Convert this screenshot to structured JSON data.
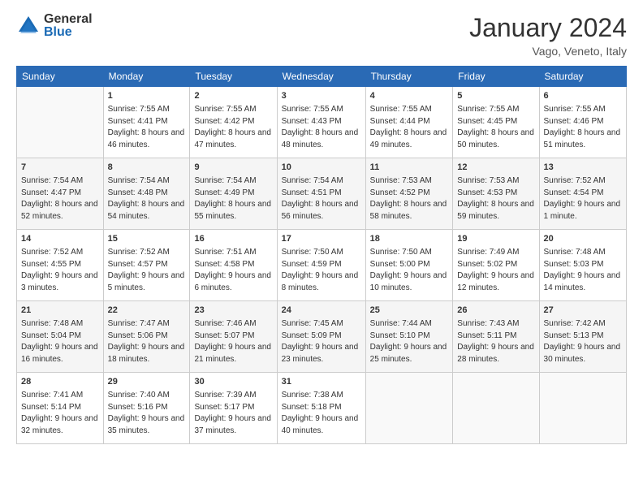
{
  "header": {
    "logo": {
      "general": "General",
      "blue": "Blue"
    },
    "title": "January 2024",
    "location": "Vago, Veneto, Italy"
  },
  "columns": [
    "Sunday",
    "Monday",
    "Tuesday",
    "Wednesday",
    "Thursday",
    "Friday",
    "Saturday"
  ],
  "weeks": [
    [
      {
        "day": "",
        "sunrise": "",
        "sunset": "",
        "daylight": ""
      },
      {
        "day": "1",
        "sunrise": "Sunrise: 7:55 AM",
        "sunset": "Sunset: 4:41 PM",
        "daylight": "Daylight: 8 hours and 46 minutes."
      },
      {
        "day": "2",
        "sunrise": "Sunrise: 7:55 AM",
        "sunset": "Sunset: 4:42 PM",
        "daylight": "Daylight: 8 hours and 47 minutes."
      },
      {
        "day": "3",
        "sunrise": "Sunrise: 7:55 AM",
        "sunset": "Sunset: 4:43 PM",
        "daylight": "Daylight: 8 hours and 48 minutes."
      },
      {
        "day": "4",
        "sunrise": "Sunrise: 7:55 AM",
        "sunset": "Sunset: 4:44 PM",
        "daylight": "Daylight: 8 hours and 49 minutes."
      },
      {
        "day": "5",
        "sunrise": "Sunrise: 7:55 AM",
        "sunset": "Sunset: 4:45 PM",
        "daylight": "Daylight: 8 hours and 50 minutes."
      },
      {
        "day": "6",
        "sunrise": "Sunrise: 7:55 AM",
        "sunset": "Sunset: 4:46 PM",
        "daylight": "Daylight: 8 hours and 51 minutes."
      }
    ],
    [
      {
        "day": "7",
        "sunrise": "Sunrise: 7:54 AM",
        "sunset": "Sunset: 4:47 PM",
        "daylight": "Daylight: 8 hours and 52 minutes."
      },
      {
        "day": "8",
        "sunrise": "Sunrise: 7:54 AM",
        "sunset": "Sunset: 4:48 PM",
        "daylight": "Daylight: 8 hours and 54 minutes."
      },
      {
        "day": "9",
        "sunrise": "Sunrise: 7:54 AM",
        "sunset": "Sunset: 4:49 PM",
        "daylight": "Daylight: 8 hours and 55 minutes."
      },
      {
        "day": "10",
        "sunrise": "Sunrise: 7:54 AM",
        "sunset": "Sunset: 4:51 PM",
        "daylight": "Daylight: 8 hours and 56 minutes."
      },
      {
        "day": "11",
        "sunrise": "Sunrise: 7:53 AM",
        "sunset": "Sunset: 4:52 PM",
        "daylight": "Daylight: 8 hours and 58 minutes."
      },
      {
        "day": "12",
        "sunrise": "Sunrise: 7:53 AM",
        "sunset": "Sunset: 4:53 PM",
        "daylight": "Daylight: 8 hours and 59 minutes."
      },
      {
        "day": "13",
        "sunrise": "Sunrise: 7:52 AM",
        "sunset": "Sunset: 4:54 PM",
        "daylight": "Daylight: 9 hours and 1 minute."
      }
    ],
    [
      {
        "day": "14",
        "sunrise": "Sunrise: 7:52 AM",
        "sunset": "Sunset: 4:55 PM",
        "daylight": "Daylight: 9 hours and 3 minutes."
      },
      {
        "day": "15",
        "sunrise": "Sunrise: 7:52 AM",
        "sunset": "Sunset: 4:57 PM",
        "daylight": "Daylight: 9 hours and 5 minutes."
      },
      {
        "day": "16",
        "sunrise": "Sunrise: 7:51 AM",
        "sunset": "Sunset: 4:58 PM",
        "daylight": "Daylight: 9 hours and 6 minutes."
      },
      {
        "day": "17",
        "sunrise": "Sunrise: 7:50 AM",
        "sunset": "Sunset: 4:59 PM",
        "daylight": "Daylight: 9 hours and 8 minutes."
      },
      {
        "day": "18",
        "sunrise": "Sunrise: 7:50 AM",
        "sunset": "Sunset: 5:00 PM",
        "daylight": "Daylight: 9 hours and 10 minutes."
      },
      {
        "day": "19",
        "sunrise": "Sunrise: 7:49 AM",
        "sunset": "Sunset: 5:02 PM",
        "daylight": "Daylight: 9 hours and 12 minutes."
      },
      {
        "day": "20",
        "sunrise": "Sunrise: 7:48 AM",
        "sunset": "Sunset: 5:03 PM",
        "daylight": "Daylight: 9 hours and 14 minutes."
      }
    ],
    [
      {
        "day": "21",
        "sunrise": "Sunrise: 7:48 AM",
        "sunset": "Sunset: 5:04 PM",
        "daylight": "Daylight: 9 hours and 16 minutes."
      },
      {
        "day": "22",
        "sunrise": "Sunrise: 7:47 AM",
        "sunset": "Sunset: 5:06 PM",
        "daylight": "Daylight: 9 hours and 18 minutes."
      },
      {
        "day": "23",
        "sunrise": "Sunrise: 7:46 AM",
        "sunset": "Sunset: 5:07 PM",
        "daylight": "Daylight: 9 hours and 21 minutes."
      },
      {
        "day": "24",
        "sunrise": "Sunrise: 7:45 AM",
        "sunset": "Sunset: 5:09 PM",
        "daylight": "Daylight: 9 hours and 23 minutes."
      },
      {
        "day": "25",
        "sunrise": "Sunrise: 7:44 AM",
        "sunset": "Sunset: 5:10 PM",
        "daylight": "Daylight: 9 hours and 25 minutes."
      },
      {
        "day": "26",
        "sunrise": "Sunrise: 7:43 AM",
        "sunset": "Sunset: 5:11 PM",
        "daylight": "Daylight: 9 hours and 28 minutes."
      },
      {
        "day": "27",
        "sunrise": "Sunrise: 7:42 AM",
        "sunset": "Sunset: 5:13 PM",
        "daylight": "Daylight: 9 hours and 30 minutes."
      }
    ],
    [
      {
        "day": "28",
        "sunrise": "Sunrise: 7:41 AM",
        "sunset": "Sunset: 5:14 PM",
        "daylight": "Daylight: 9 hours and 32 minutes."
      },
      {
        "day": "29",
        "sunrise": "Sunrise: 7:40 AM",
        "sunset": "Sunset: 5:16 PM",
        "daylight": "Daylight: 9 hours and 35 minutes."
      },
      {
        "day": "30",
        "sunrise": "Sunrise: 7:39 AM",
        "sunset": "Sunset: 5:17 PM",
        "daylight": "Daylight: 9 hours and 37 minutes."
      },
      {
        "day": "31",
        "sunrise": "Sunrise: 7:38 AM",
        "sunset": "Sunset: 5:18 PM",
        "daylight": "Daylight: 9 hours and 40 minutes."
      },
      {
        "day": "",
        "sunrise": "",
        "sunset": "",
        "daylight": ""
      },
      {
        "day": "",
        "sunrise": "",
        "sunset": "",
        "daylight": ""
      },
      {
        "day": "",
        "sunrise": "",
        "sunset": "",
        "daylight": ""
      }
    ]
  ]
}
